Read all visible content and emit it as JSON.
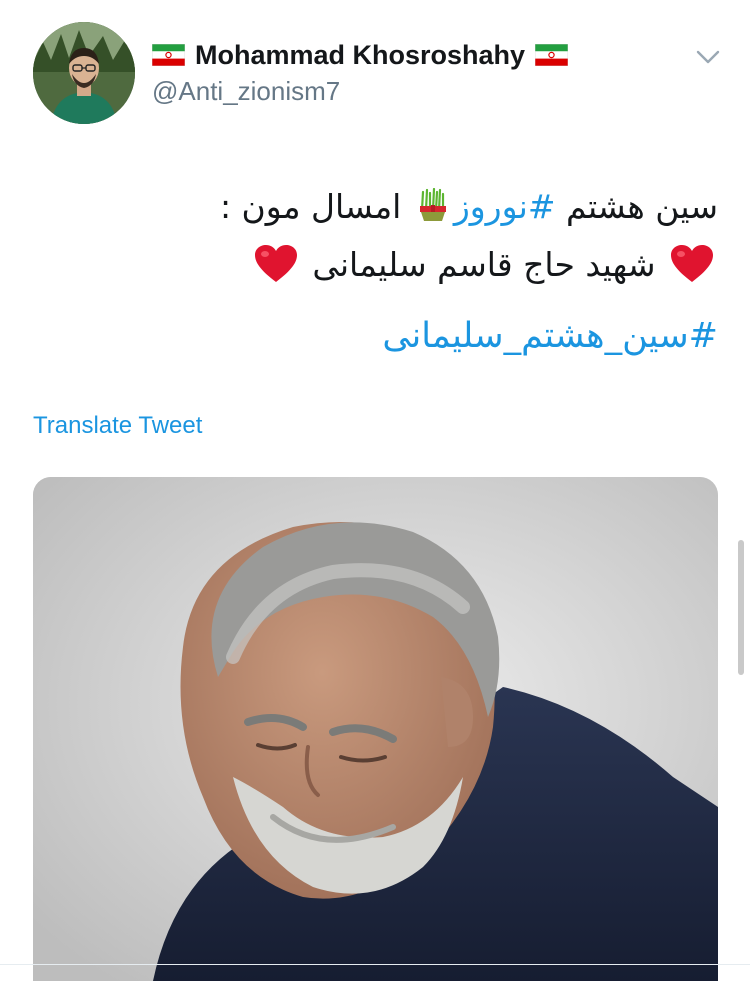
{
  "tweet": {
    "author": {
      "display_name": "Mohammad Khosroshahy",
      "handle": "@Anti_zionism7",
      "flag_icon": "iran-flag-icon"
    },
    "menu_icon": "chevron-down-icon",
    "lines": {
      "line1_before_tag": "سین هشتم ",
      "line1_hashtag": "#نوروز",
      "line1_after_emoji": " امسال مون :",
      "line2_text": " شهید حاج قاسم سلیمانی "
    },
    "emoji": {
      "sabzeh": "sabzeh-icon",
      "heart": "red-heart-icon"
    },
    "hashtag_line": "#سین_هشتم_سلیمانی",
    "translate_label": "Translate Tweet",
    "media": {
      "type": "photo"
    }
  },
  "colors": {
    "link": "#1b95e0",
    "text": "#14171a",
    "secondary": "#657786",
    "heart": "#e0142f",
    "iran_green": "#239f40",
    "iran_red": "#da0000"
  }
}
